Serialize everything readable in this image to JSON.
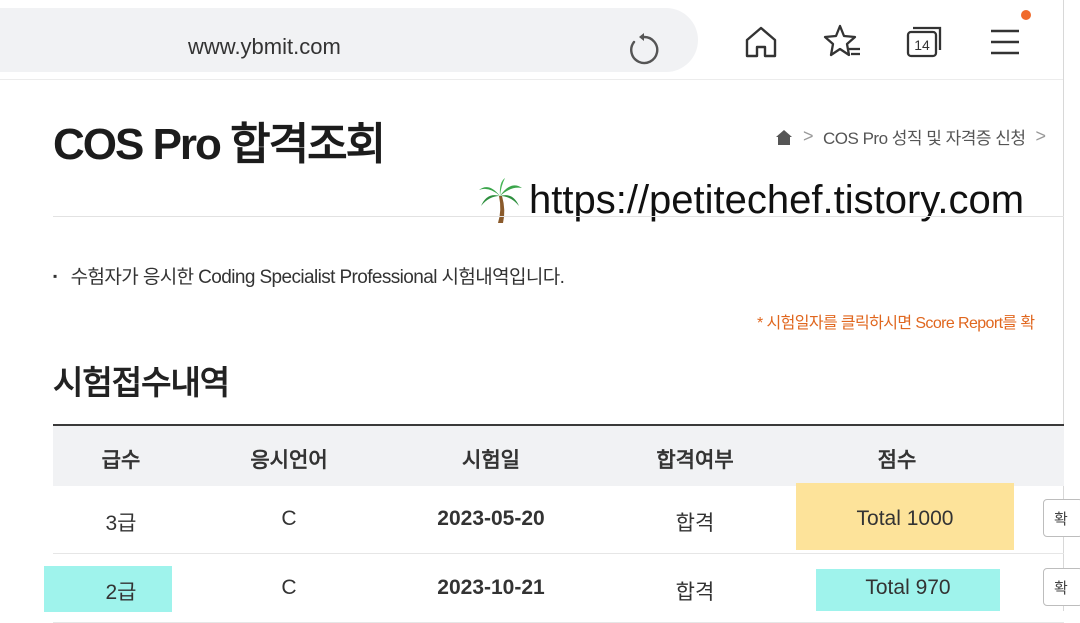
{
  "browser": {
    "url": "www.ybmit.com",
    "tab_count": "14"
  },
  "page": {
    "title": "COS Pro 합격조회",
    "breadcrumb": [
      "COS Pro 성직 및 자격증 신청"
    ],
    "watermark": "https://petitechef.tistory.com",
    "notice": "수험자가 응시한 Coding Specialist Professional 시험내역입니다.",
    "score_note": "* 시험일자를 클릭하시면 Score Report를 확",
    "section_title": "시험접수내역"
  },
  "table": {
    "headers": [
      "급수",
      "응시언어",
      "시험일",
      "합격여부",
      "점수"
    ],
    "rows": [
      {
        "level": "3급",
        "language": "C",
        "date": "2023-05-20",
        "result": "합격",
        "score": "Total 1000",
        "button": "확"
      },
      {
        "level": "2급",
        "language": "C",
        "date": "2023-10-21",
        "result": "합격",
        "score": "Total 970",
        "button": "확"
      }
    ]
  },
  "colors": {
    "highlight_yellow": "#fde39a",
    "highlight_cyan": "#9ff3ec",
    "note_orange": "#e0671f",
    "notification_dot": "#f06a2b"
  },
  "icons": [
    "reload-icon",
    "home-icon",
    "favorites-star-icon",
    "tabs-icon",
    "menu-icon",
    "breadcrumb-home-icon",
    "palm-tree-icon"
  ]
}
